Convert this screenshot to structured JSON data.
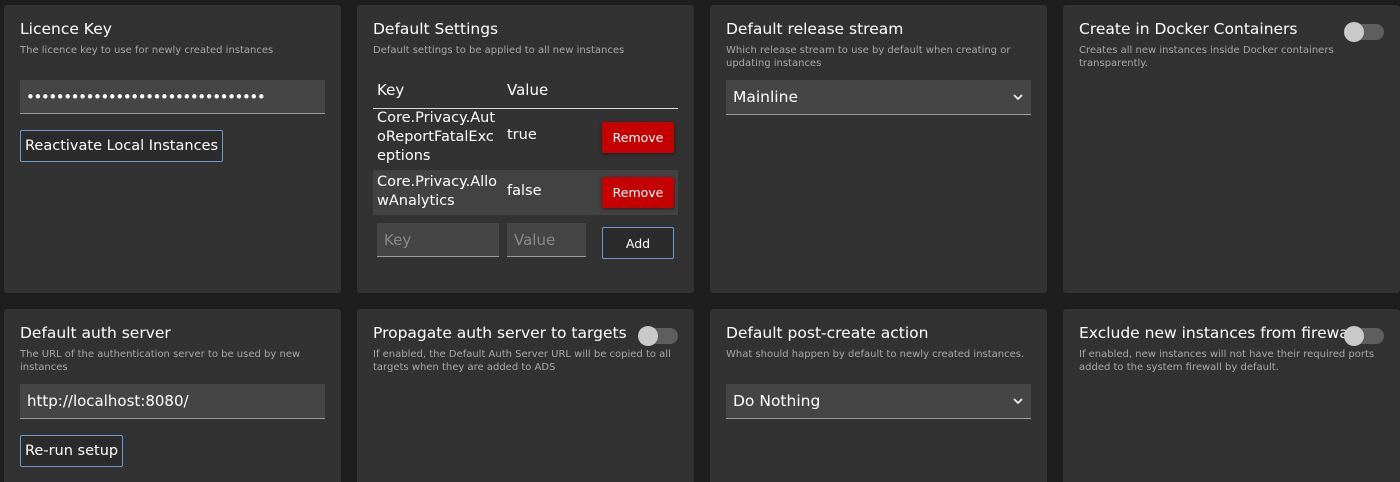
{
  "licence": {
    "title": "Licence Key",
    "description": "The licence key to use for newly created instances",
    "value": "••••••••••••••••••••••••••••••••",
    "reactivate_label": "Reactivate Local Instances"
  },
  "default_settings": {
    "title": "Default Settings",
    "description": "Default settings to be applied to all new instances",
    "col_key": "Key",
    "col_value": "Value",
    "rows": [
      {
        "key": "Core.Privacy.AutoReportFatalExceptions",
        "value": "true",
        "remove_label": "Remove"
      },
      {
        "key": "Core.Privacy.AllowAnalytics",
        "value": "false",
        "remove_label": "Remove"
      }
    ],
    "key_placeholder": "Key",
    "value_placeholder": "Value",
    "add_label": "Add"
  },
  "release_stream": {
    "title": "Default release stream",
    "description": "Which release stream to use by default when creating or updating instances",
    "selected": "Mainline"
  },
  "docker": {
    "title": "Create in Docker Containers",
    "description": "Creates all new instances inside Docker containers transparently.",
    "enabled": false
  },
  "auth_server": {
    "title": "Default auth server",
    "description": "The URL of the authentication server to be used by new instances",
    "value": "http://localhost:8080/",
    "rerun_label": "Re-run setup"
  },
  "propagate": {
    "title": "Propagate auth server to targets",
    "description": "If enabled, the Default Auth Server URL will be copied to all targets when they are added to ADS",
    "enabled": false
  },
  "post_create": {
    "title": "Default post-create action",
    "description": "What should happen by default to newly created instances.",
    "selected": "Do Nothing"
  },
  "firewall": {
    "title": "Exclude new instances from firewall",
    "description": "If enabled, new instances will not have their required ports added to the system firewall by default.",
    "enabled": false
  },
  "colors": {
    "background": "#1e1e1e",
    "card": "#323232",
    "danger": "#c40000",
    "accent": "#6d9bd1"
  }
}
